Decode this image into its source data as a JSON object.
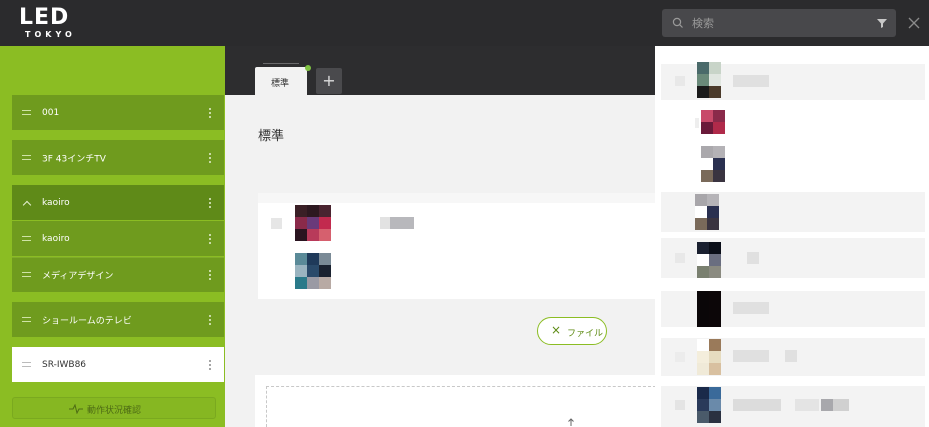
{
  "header": {
    "logo_main": "LED",
    "logo_sub": "TOKYO",
    "search_placeholder": "検索"
  },
  "sidebar": {
    "items": [
      {
        "label": "001",
        "icon": "drag-handle-icon"
      },
      {
        "label": "3F 43インチTV",
        "icon": "drag-handle-icon"
      },
      {
        "label": "kaoiro",
        "icon": "chevron-up-icon",
        "expanded": true
      },
      {
        "label": "kaoiro",
        "icon": "drag-handle-icon"
      },
      {
        "label": "メディアデザイン",
        "icon": "drag-handle-icon"
      },
      {
        "label": "ショールームのテレビ",
        "icon": "drag-handle-icon"
      },
      {
        "label": "SR-IWB86",
        "icon": "drag-handle-icon",
        "selected": true
      }
    ],
    "status_button": "動作状況確認"
  },
  "tabs": [
    {
      "label": "標準",
      "active": true
    }
  ],
  "tab_add_label": "+",
  "main": {
    "title": "標準",
    "file_button": "ファイル"
  },
  "colors": {
    "brand_green": "#8bbd23",
    "sidebar_item": "#6f9b1e",
    "header_bg": "#2b2b2d",
    "tab_dot": "#7fc243"
  }
}
